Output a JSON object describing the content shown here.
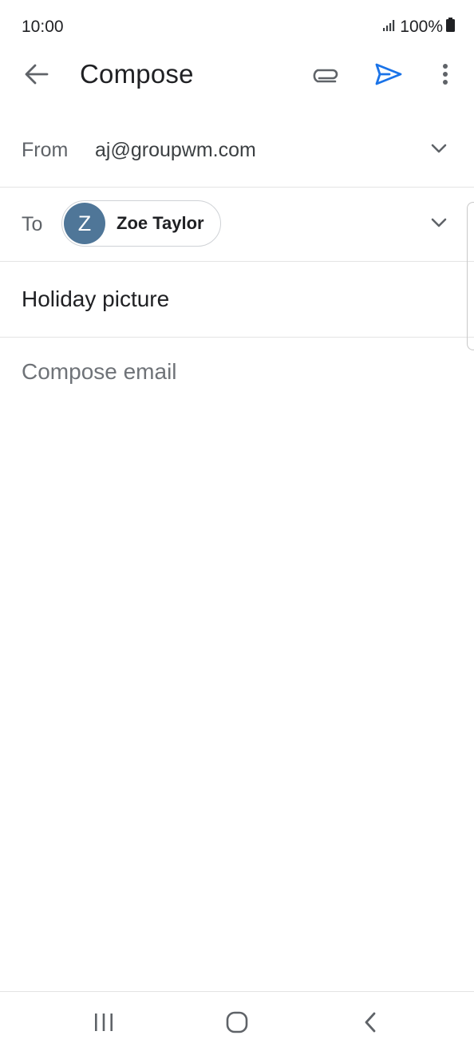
{
  "status_bar": {
    "time": "10:00",
    "battery": "100%"
  },
  "app_bar": {
    "title": "Compose",
    "icons": [
      "back-arrow-icon",
      "paperclip-icon",
      "send-icon",
      "more-vert-icon"
    ],
    "send_color": "#1a73e8"
  },
  "from": {
    "label": "From",
    "value": "aj@groupwm.com"
  },
  "to": {
    "label": "To",
    "recipient": {
      "initial": "Z",
      "name": "Zoe Taylor",
      "avatar_color": "#4f7698"
    }
  },
  "subject": {
    "value": "Holiday picture"
  },
  "body": {
    "placeholder": "Compose email"
  },
  "nav_bar": {
    "icons": [
      "recent-apps-icon",
      "home-icon",
      "back-icon"
    ]
  }
}
